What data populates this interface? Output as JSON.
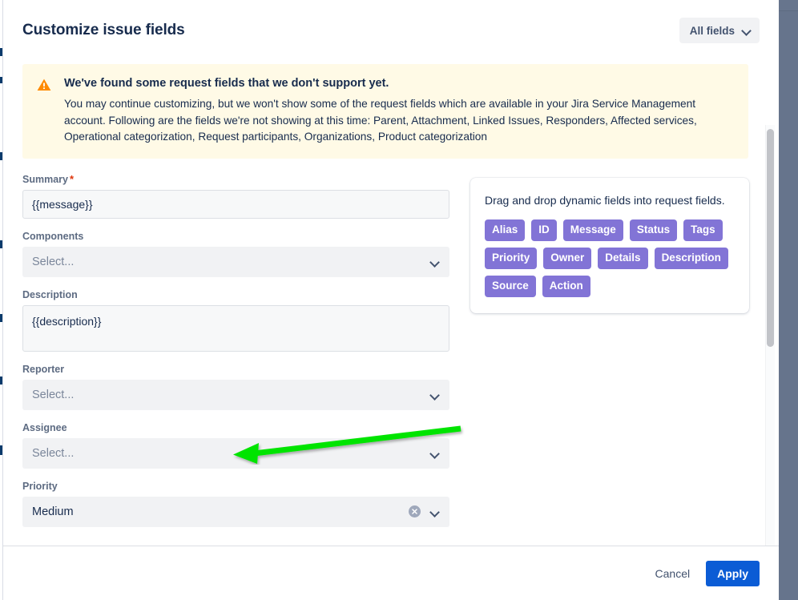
{
  "window": {
    "title": "Customize issue fields"
  },
  "header": {
    "title": "Customize issue fields",
    "all_fields_label": "All fields",
    "all_fields_icon": "chevron-down-icon"
  },
  "warning_banner": {
    "icon": "warning-triangle-icon",
    "icon_color": "#ff8b00",
    "background": "#fffae6",
    "title": "We've found some request fields that we don't support yet.",
    "body": "You may continue customizing, but we won't show some of the request fields which are available in your Jira Service Management account. Following are the fields we're not showing at this time: Parent, Attachment, Linked Issues, Responders, Affected services, Operational categorization, Request participants, Organizations, Product categorization"
  },
  "form": {
    "fields": [
      {
        "label": "Summary",
        "required": true,
        "required_mark": "*",
        "type": "text",
        "value": "{{message}}",
        "name": "summary"
      },
      {
        "label": "Components",
        "required": false,
        "type": "select",
        "value": "Select...",
        "is_placeholder": true,
        "name": "components"
      },
      {
        "label": "Description",
        "required": false,
        "type": "textarea",
        "value": "{{description}}",
        "name": "description"
      },
      {
        "label": "Reporter",
        "required": false,
        "type": "select",
        "value": "Select...",
        "is_placeholder": true,
        "name": "reporter"
      },
      {
        "label": "Assignee",
        "required": false,
        "type": "select",
        "value": "Select...",
        "is_placeholder": true,
        "name": "assignee"
      },
      {
        "label": "Priority",
        "required": false,
        "type": "select",
        "value": "Medium",
        "is_placeholder": false,
        "clearable": true,
        "name": "priority"
      }
    ]
  },
  "dynamic_fields_panel": {
    "hint": "Drag and drop dynamic fields into request fields.",
    "chip_color": "#8274d6",
    "chips": [
      "Alias",
      "ID",
      "Message",
      "Status",
      "Tags",
      "Priority",
      "Owner",
      "Details",
      "Description",
      "Source",
      "Action"
    ]
  },
  "footer": {
    "cancel_label": "Cancel",
    "apply_label": "Apply",
    "apply_color": "#0b5cd5"
  },
  "annotation": {
    "type": "arrow",
    "color": "#00e400",
    "points_to": "assignee-select",
    "direction": "left"
  },
  "scrollbar": {
    "orientation": "vertical",
    "thumb_color": "#c1c3c8"
  }
}
